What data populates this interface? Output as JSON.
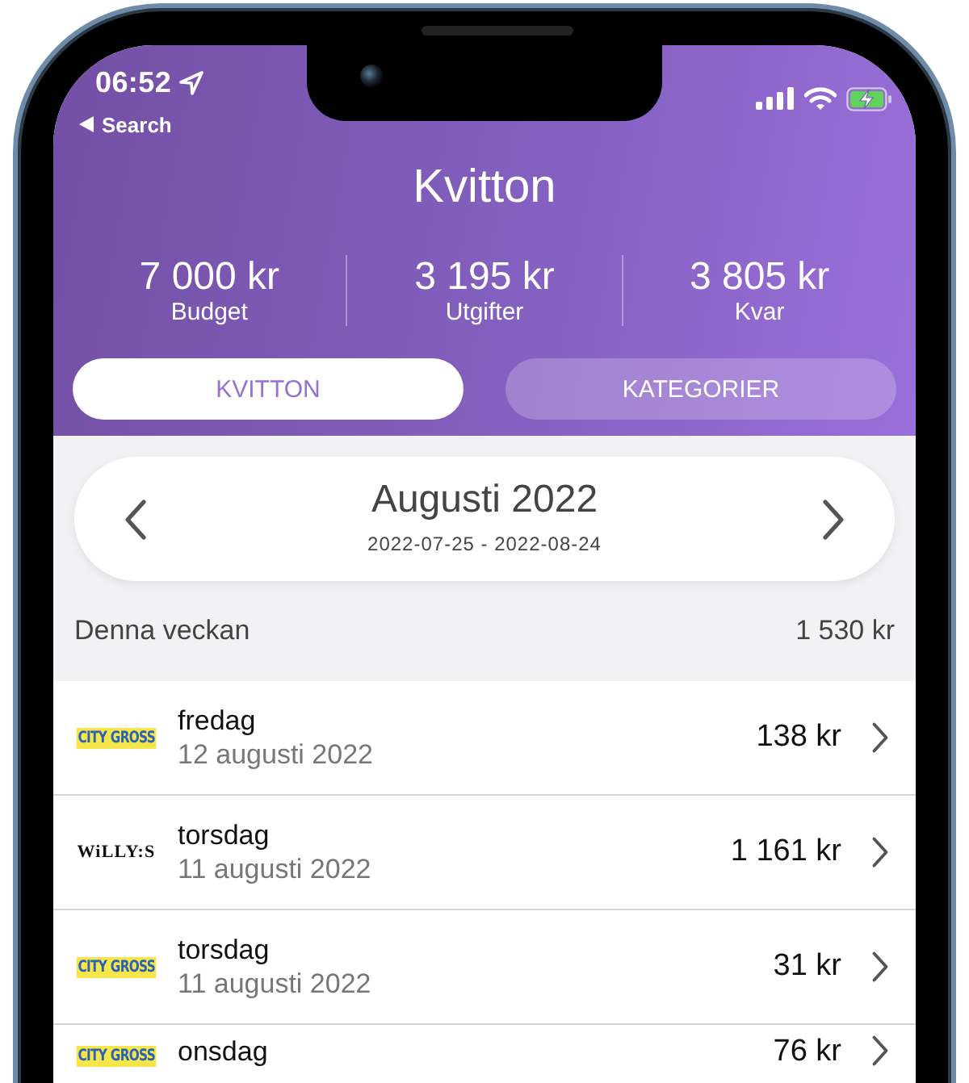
{
  "status_bar": {
    "time": "06:52",
    "back_link": "Search"
  },
  "title": "Kvitton",
  "stats": [
    {
      "value": "7 000 kr",
      "label": "Budget"
    },
    {
      "value": "3 195 kr",
      "label": "Utgifter"
    },
    {
      "value": "3 805 kr",
      "label": "Kvar"
    }
  ],
  "tabs": [
    {
      "label": "KVITTON",
      "selected": true
    },
    {
      "label": "KATEGORIER",
      "selected": false
    }
  ],
  "period": {
    "month": "Augusti 2022",
    "range": "2022-07-25 - 2022-08-24"
  },
  "section": {
    "title": "Denna veckan",
    "total": "1 530 kr"
  },
  "receipts": [
    {
      "logo": {
        "kind": "citygross",
        "text": "CITY GROSS"
      },
      "day": "fredag",
      "date": "12 augusti 2022",
      "amount": "138 kr"
    },
    {
      "logo": {
        "kind": "willys",
        "text": "WiLLY:S"
      },
      "day": "torsdag",
      "date": "11 augusti 2022",
      "amount": "1 161 kr"
    },
    {
      "logo": {
        "kind": "citygross",
        "text": "CITY GROSS"
      },
      "day": "torsdag",
      "date": "11 augusti 2022",
      "amount": "31 kr"
    },
    {
      "logo": {
        "kind": "citygross",
        "text": "CITY GROSS"
      },
      "day": "onsdag",
      "amount": "76 kr"
    }
  ]
}
